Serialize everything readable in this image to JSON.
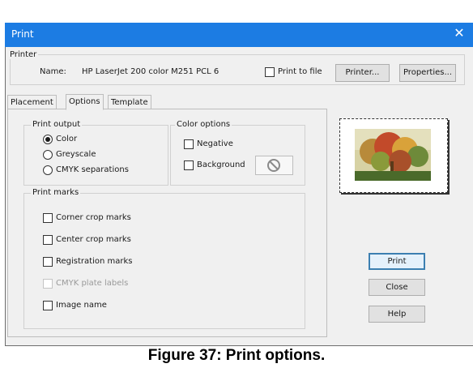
{
  "window": {
    "title": "Print",
    "close_glyph": "✕"
  },
  "printer": {
    "group_label": "Printer",
    "name_label": "Name:",
    "name_value": "HP LaserJet 200 color M251 PCL 6",
    "print_to_file_label": "Print to file",
    "print_to_file_checked": false,
    "printer_button": "Printer...",
    "properties_button": "Properties..."
  },
  "tabs": [
    "Placement",
    "Options",
    "Template"
  ],
  "active_tab": "Options",
  "print_output": {
    "label": "Print output",
    "options": [
      "Color",
      "Greyscale",
      "CMYK separations"
    ],
    "selected": "Color"
  },
  "color_options": {
    "label": "Color options",
    "negative_label": "Negative",
    "background_label": "Background"
  },
  "print_marks": {
    "label": "Print marks",
    "items": [
      "Corner crop marks",
      "Center crop marks",
      "Registration marks",
      "CMYK plate labels",
      "Image name"
    ]
  },
  "buttons": {
    "print": "Print",
    "close": "Close",
    "help": "Help"
  },
  "caption": "Figure 37: Print options.",
  "colors": {
    "titlebar": "#1c7ce3",
    "default_button_border": "#3c7fb1"
  }
}
